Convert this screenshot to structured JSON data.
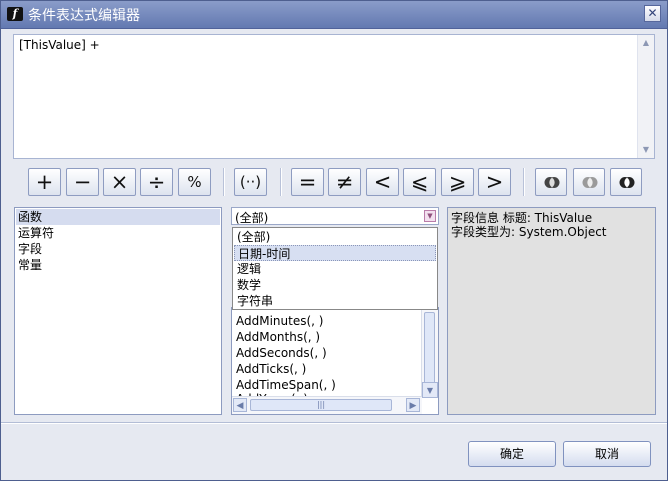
{
  "window": {
    "title": "条件表达式编辑器",
    "close_glyph": "✕",
    "app_icon_glyph": "f"
  },
  "expression": {
    "text": "[ThisValue] +"
  },
  "operators": [
    {
      "label": "+"
    },
    {
      "label": "−"
    },
    {
      "label": "×"
    },
    {
      "label": "÷"
    },
    {
      "label": "%"
    },
    {
      "label": "(··)"
    },
    {
      "label": "="
    },
    {
      "label": "≠"
    },
    {
      "label": "<"
    },
    {
      "label": "⩽"
    },
    {
      "label": "⩾"
    },
    {
      "label": ">"
    }
  ],
  "logic_buttons": [
    "and-icon",
    "or-icon",
    "not-icon"
  ],
  "categories": {
    "items": [
      "函数",
      "运算符",
      "字段",
      "常量"
    ],
    "selected": "函数"
  },
  "function_filter": {
    "value": "(全部)",
    "options": [
      "(全部)",
      "日期-时间",
      "逻辑",
      "数学",
      "字符串"
    ],
    "highlighted": "日期-时间"
  },
  "functions": [
    "AddMinutes(, )",
    "AddMonths(, )",
    "AddSeconds(, )",
    "AddTicks(, )",
    "AddTimeSpan(, )",
    "AddYears(, )"
  ],
  "info": {
    "line1": "字段信息 标题: ThisValue",
    "line2": " 字段类型为: System.Object"
  },
  "buttons": {
    "ok": "确定",
    "cancel": "取消"
  }
}
